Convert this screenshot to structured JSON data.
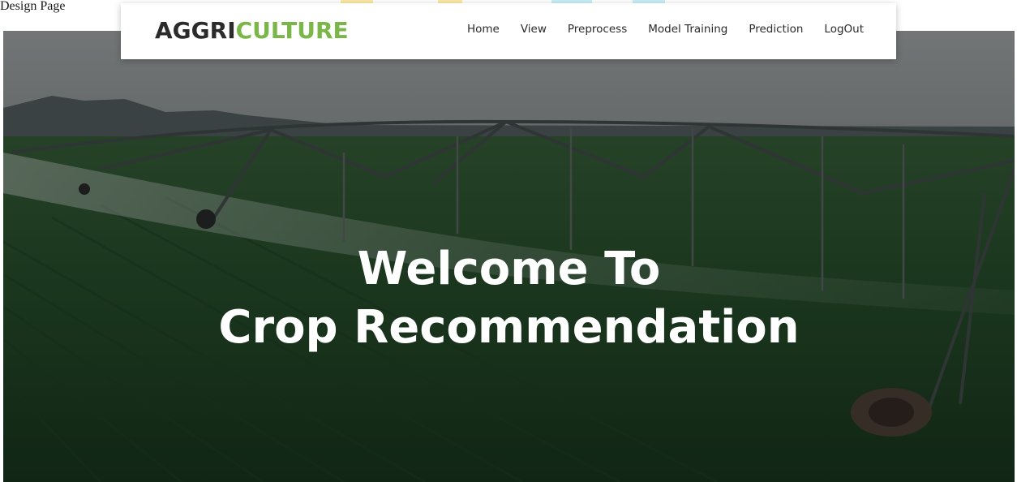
{
  "page": {
    "snippet_text": "Design Page"
  },
  "navbar": {
    "brand_part1": "AGGRI",
    "brand_part2": "CULTURE",
    "items": [
      {
        "label": "Home"
      },
      {
        "label": "View"
      },
      {
        "label": "Preprocess"
      },
      {
        "label": "Model Training"
      },
      {
        "label": "Prediction"
      },
      {
        "label": "LogOut"
      }
    ]
  },
  "hero": {
    "title_line1": "Welcome To",
    "title_line2": "Crop Recommendation"
  },
  "colors": {
    "brand_dark": "#2b2b2b",
    "brand_green": "#7ab648",
    "nav_text": "#2b2b2b",
    "navbar_bg": "#ffffff",
    "hero_text": "#ffffff"
  }
}
